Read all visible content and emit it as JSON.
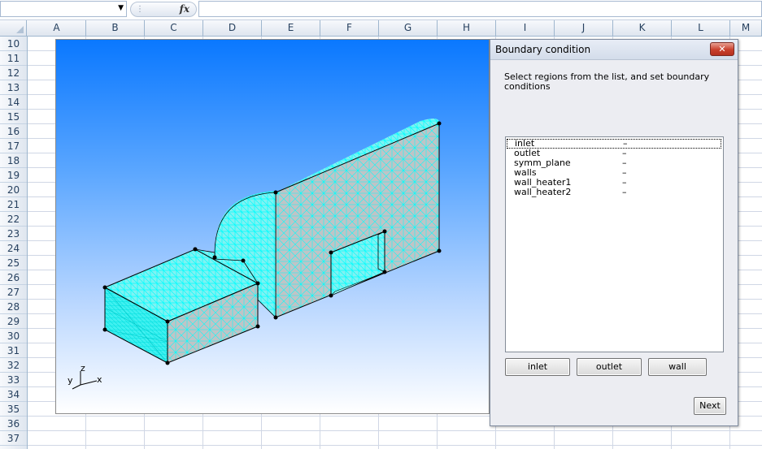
{
  "formula_bar": {
    "name_box_value": "",
    "fx_label": "fx",
    "formula_value": ""
  },
  "columns": [
    "A",
    "B",
    "C",
    "D",
    "E",
    "F",
    "G",
    "H",
    "I",
    "J",
    "K",
    "L",
    "M"
  ],
  "rows": [
    "10",
    "11",
    "12",
    "13",
    "14",
    "15",
    "16",
    "17",
    "18",
    "19",
    "20",
    "21",
    "22",
    "23",
    "24",
    "25",
    "26",
    "27",
    "28",
    "29",
    "30",
    "31",
    "32",
    "33",
    "34",
    "35",
    "36",
    "37"
  ],
  "viewport": {
    "axis_labels": {
      "z": "z",
      "y": "y",
      "x": "x"
    },
    "colors": {
      "mesh": "#00ffff",
      "solid": "#c0c0c0",
      "edge": "#000000",
      "bg_top": "#0a78ff",
      "bg_bottom": "#ffffff"
    }
  },
  "dialog": {
    "title": "Boundary condition",
    "close_label": "✕",
    "instruction": "Select regions from the list, and set boundary conditions",
    "regions": [
      {
        "name": "inlet",
        "value": "–"
      },
      {
        "name": "outlet",
        "value": "–"
      },
      {
        "name": "symm_plane",
        "value": "–"
      },
      {
        "name": "walls",
        "value": "–"
      },
      {
        "name": "wall_heater1",
        "value": "–"
      },
      {
        "name": "wall_heater2",
        "value": "–"
      }
    ],
    "buttons": {
      "inlet": "inlet",
      "outlet": "outlet",
      "wall": "wall",
      "next": "Next"
    }
  }
}
